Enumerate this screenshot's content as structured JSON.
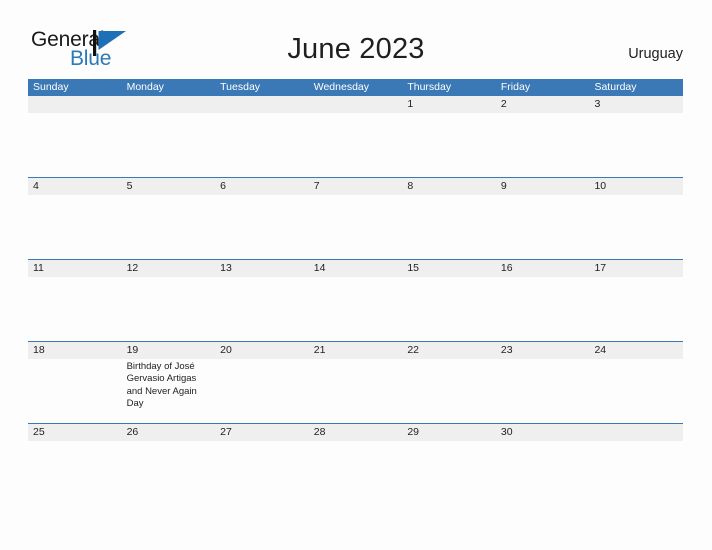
{
  "brand": {
    "name_part1": "General",
    "name_part2": "Blue",
    "mark": "blue-flag-triangle",
    "accent_color": "#2a7ab9"
  },
  "header": {
    "title": "June 2023",
    "country": "Uruguay"
  },
  "colors": {
    "header_blue": "#3a79b5",
    "date_band_gray": "#efefef",
    "page_background": "#fdfdfd",
    "text": "#1f1f1f",
    "header_text": "#ffffff"
  },
  "calendar": {
    "weekdays": [
      "Sunday",
      "Monday",
      "Tuesday",
      "Wednesday",
      "Thursday",
      "Friday",
      "Saturday"
    ],
    "weeks": [
      {
        "days": [
          {
            "date": "",
            "events": []
          },
          {
            "date": "",
            "events": []
          },
          {
            "date": "",
            "events": []
          },
          {
            "date": "",
            "events": []
          },
          {
            "date": "1",
            "events": []
          },
          {
            "date": "2",
            "events": []
          },
          {
            "date": "3",
            "events": []
          }
        ]
      },
      {
        "days": [
          {
            "date": "4",
            "events": []
          },
          {
            "date": "5",
            "events": []
          },
          {
            "date": "6",
            "events": []
          },
          {
            "date": "7",
            "events": []
          },
          {
            "date": "8",
            "events": []
          },
          {
            "date": "9",
            "events": []
          },
          {
            "date": "10",
            "events": []
          }
        ]
      },
      {
        "days": [
          {
            "date": "11",
            "events": []
          },
          {
            "date": "12",
            "events": []
          },
          {
            "date": "13",
            "events": []
          },
          {
            "date": "14",
            "events": []
          },
          {
            "date": "15",
            "events": []
          },
          {
            "date": "16",
            "events": []
          },
          {
            "date": "17",
            "events": []
          }
        ]
      },
      {
        "days": [
          {
            "date": "18",
            "events": []
          },
          {
            "date": "19",
            "events": [
              "Birthday of José Gervasio Artigas and Never Again Day"
            ]
          },
          {
            "date": "20",
            "events": []
          },
          {
            "date": "21",
            "events": []
          },
          {
            "date": "22",
            "events": []
          },
          {
            "date": "23",
            "events": []
          },
          {
            "date": "24",
            "events": []
          }
        ]
      },
      {
        "days": [
          {
            "date": "25",
            "events": []
          },
          {
            "date": "26",
            "events": []
          },
          {
            "date": "27",
            "events": []
          },
          {
            "date": "28",
            "events": []
          },
          {
            "date": "29",
            "events": []
          },
          {
            "date": "30",
            "events": []
          },
          {
            "date": "",
            "events": []
          }
        ]
      }
    ]
  }
}
